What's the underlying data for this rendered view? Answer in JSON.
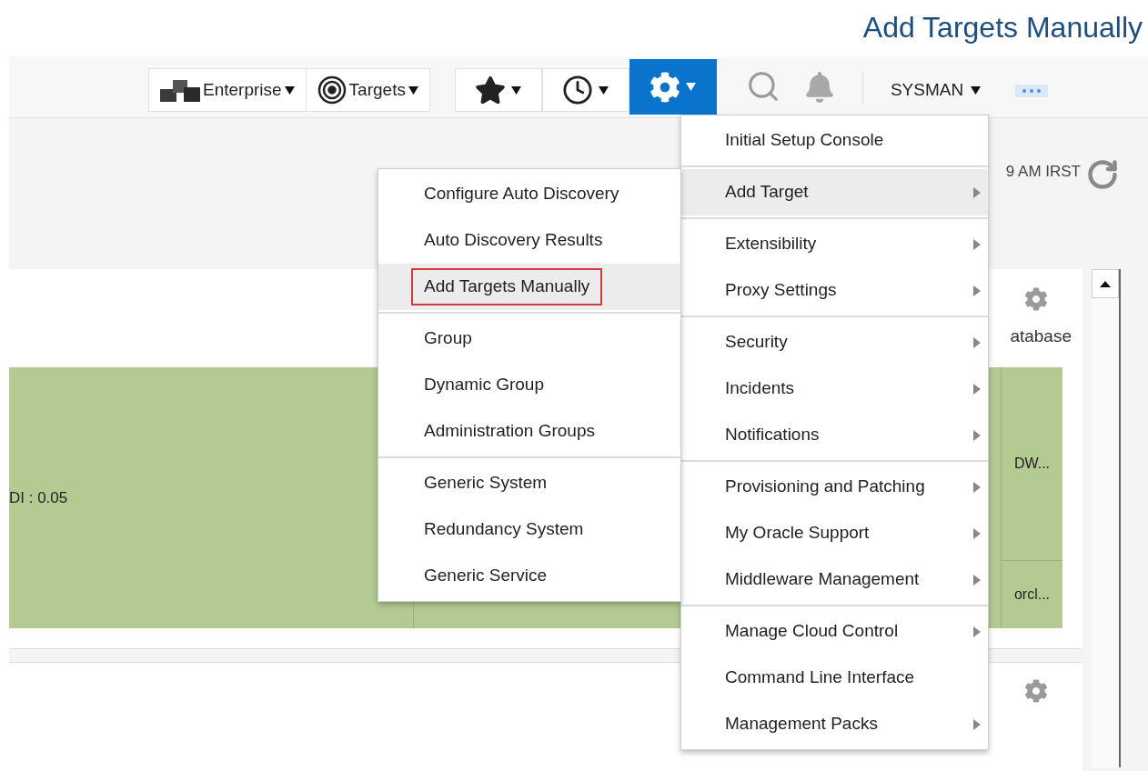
{
  "heading": "Add Targets Manually",
  "toolbar": {
    "menus": [
      {
        "label": "Enterprise",
        "kind": "enterprise"
      },
      {
        "label": "Targets",
        "kind": "targets"
      }
    ],
    "tools": [
      {
        "kind": "favorites",
        "selected": false
      },
      {
        "kind": "history",
        "selected": false
      },
      {
        "kind": "setup",
        "selected": true
      }
    ],
    "user": "SYSMAN"
  },
  "dashboard": {
    "refresh_time": "9 AM IRST",
    "column_label": "atabase",
    "metric": "DI : 0.05",
    "cells": [
      "DW...",
      "orcl..."
    ]
  },
  "setup_menu": [
    [
      {
        "label": "Initial Setup Console",
        "submenu": false,
        "selected": false
      }
    ],
    [
      {
        "label": "Add Target",
        "submenu": true,
        "selected": true
      }
    ],
    [
      {
        "label": "Extensibility",
        "submenu": true,
        "selected": false
      },
      {
        "label": "Proxy Settings",
        "submenu": true,
        "selected": false
      }
    ],
    [
      {
        "label": "Security",
        "submenu": true,
        "selected": false
      },
      {
        "label": "Incidents",
        "submenu": true,
        "selected": false
      },
      {
        "label": "Notifications",
        "submenu": true,
        "selected": false
      }
    ],
    [
      {
        "label": "Provisioning and Patching",
        "submenu": true,
        "selected": false
      },
      {
        "label": "My Oracle Support",
        "submenu": true,
        "selected": false
      },
      {
        "label": "Middleware Management",
        "submenu": true,
        "selected": false
      }
    ],
    [
      {
        "label": "Manage Cloud Control",
        "submenu": true,
        "selected": false
      },
      {
        "label": "Command Line Interface",
        "submenu": false,
        "selected": false
      },
      {
        "label": "Management Packs",
        "submenu": true,
        "selected": false
      }
    ]
  ],
  "add_target_menu": [
    [
      {
        "label": "Configure Auto Discovery",
        "selected": false,
        "highlighted_box": false
      },
      {
        "label": "Auto Discovery Results",
        "selected": false,
        "highlighted_box": false
      },
      {
        "label": "Add Targets Manually",
        "selected": true,
        "highlighted_box": true
      }
    ],
    [
      {
        "label": "Group",
        "selected": false,
        "highlighted_box": false
      },
      {
        "label": "Dynamic Group",
        "selected": false,
        "highlighted_box": false
      },
      {
        "label": "Administration Groups",
        "selected": false,
        "highlighted_box": false
      }
    ],
    [
      {
        "label": "Generic System",
        "selected": false,
        "highlighted_box": false
      },
      {
        "label": "Redundancy System",
        "selected": false,
        "highlighted_box": false
      },
      {
        "label": "Generic Service",
        "selected": false,
        "highlighted_box": false
      }
    ]
  ]
}
